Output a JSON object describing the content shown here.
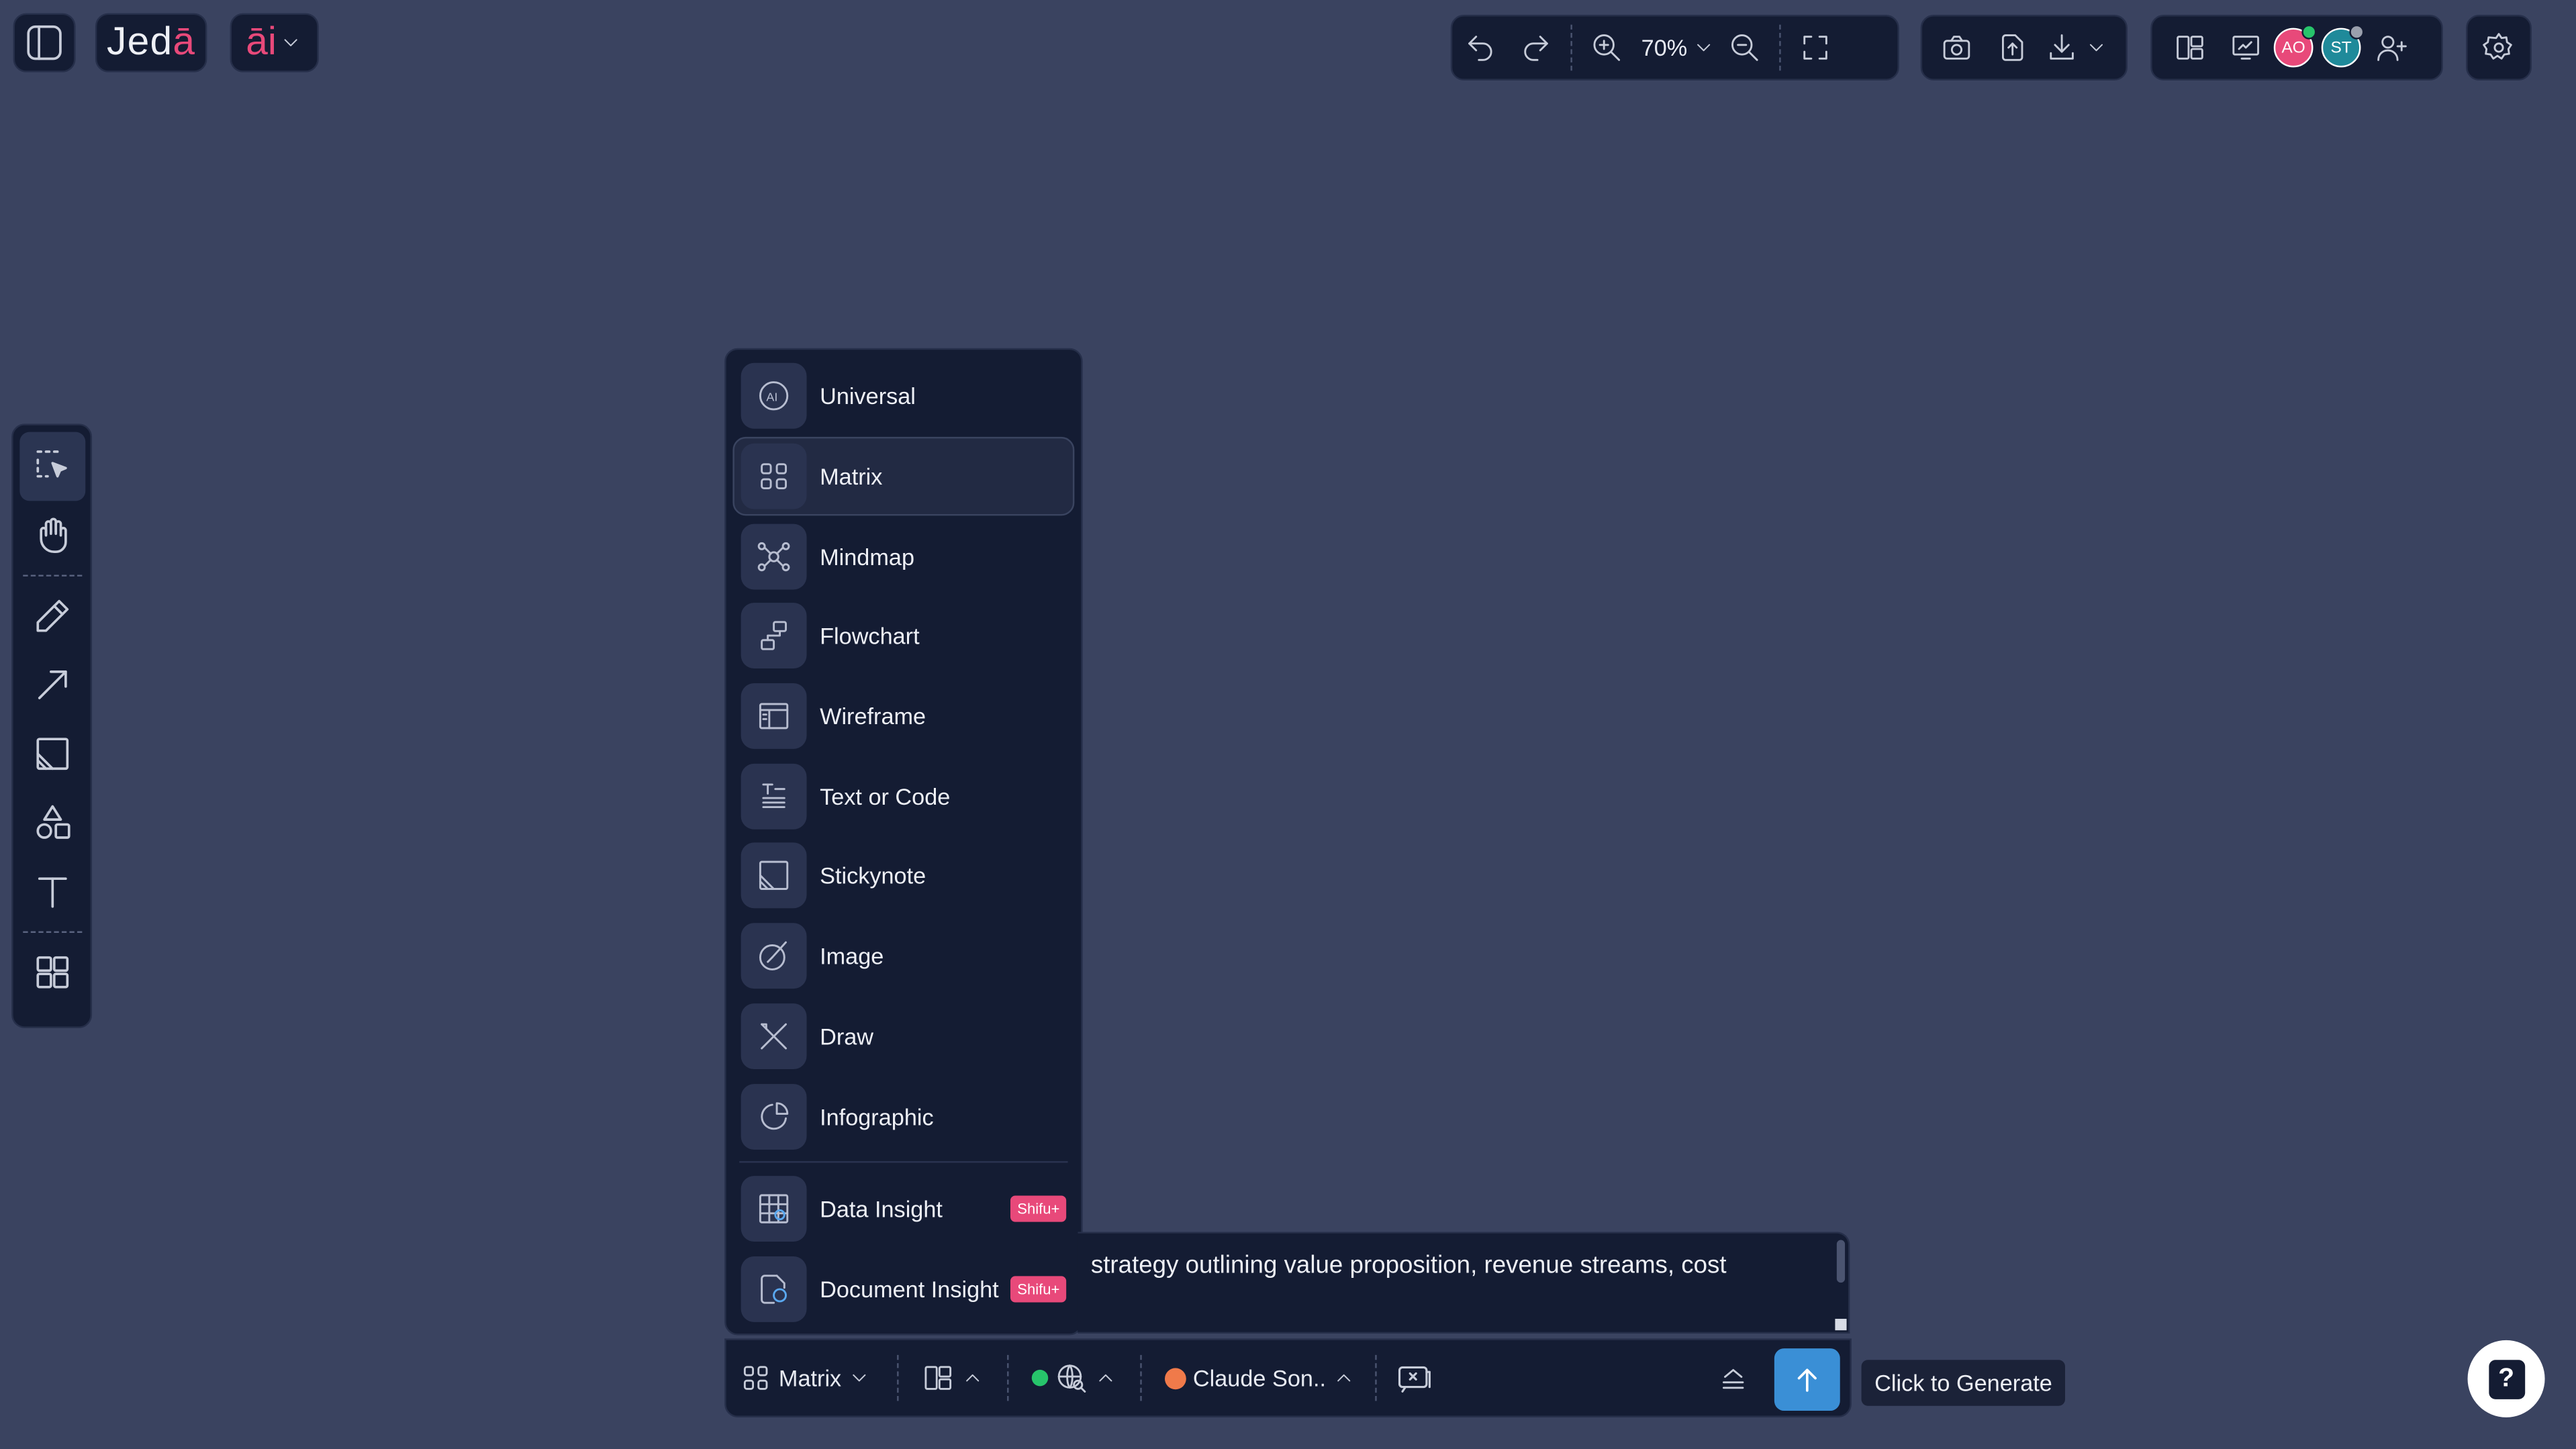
{
  "app": {
    "logo_main": "Jed",
    "logo_accent": "ā",
    "ai_label": "āi"
  },
  "toolbar": {
    "zoom_value": "70%"
  },
  "collaborators": [
    {
      "initials": "AO",
      "color": "#e8497a",
      "status_color": "#27c46b"
    },
    {
      "initials": "ST",
      "color": "#1f8a9a",
      "status_color": "#9aa0ad"
    }
  ],
  "tools": [
    "select-tool",
    "hand-tool",
    "pencil-tool",
    "arrow-tool",
    "sticky-tool",
    "shapes-tool",
    "text-tool",
    "templates-tool"
  ],
  "menu": {
    "items": [
      {
        "label": "Universal",
        "icon": "ai-circle-icon",
        "selected": false
      },
      {
        "label": "Matrix",
        "icon": "matrix-grid-icon",
        "selected": true
      },
      {
        "label": "Mindmap",
        "icon": "mindmap-icon",
        "selected": false
      },
      {
        "label": "Flowchart",
        "icon": "flowchart-icon",
        "selected": false
      },
      {
        "label": "Wireframe",
        "icon": "wireframe-icon",
        "selected": false
      },
      {
        "label": "Text or Code",
        "icon": "text-code-icon",
        "selected": false
      },
      {
        "label": "Stickynote",
        "icon": "stickynote-icon",
        "selected": false
      },
      {
        "label": "Image",
        "icon": "image-brush-icon",
        "selected": false
      },
      {
        "label": "Draw",
        "icon": "draw-pen-icon",
        "selected": false
      },
      {
        "label": "Infographic",
        "icon": "pie-chart-icon",
        "selected": false
      }
    ],
    "premium_items": [
      {
        "label": "Data Insight",
        "icon": "data-grid-icon",
        "badge": "Shifu+"
      },
      {
        "label": "Document Insight",
        "icon": "document-insight-icon",
        "badge": "Shifu+"
      }
    ]
  },
  "prompt": {
    "text": "strategy outlining value proposition, revenue streams, cost"
  },
  "generate_bar": {
    "mode_label": "Matrix",
    "model_label": "Claude Son..",
    "web_status_color": "#27c46b",
    "model_color": "#f07a4a"
  },
  "tooltip": {
    "text": "Click to Generate"
  },
  "help": {
    "label": "?"
  },
  "colors": {
    "canvas": "#3a4360",
    "panel": "#141c33",
    "accent_pink": "#e8497a",
    "generate_blue": "#3a8fd6"
  }
}
